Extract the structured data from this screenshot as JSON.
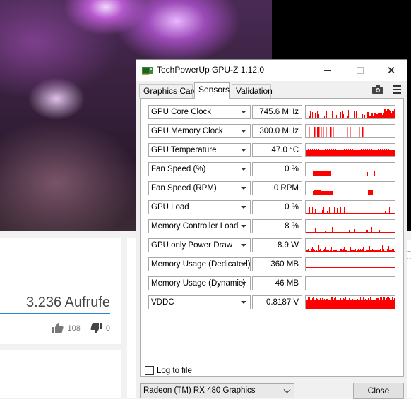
{
  "youtube": {
    "views": "3.236 Aufrufe",
    "likes": "108",
    "dislikes": "0"
  },
  "window": {
    "title": "TechPowerUp GPU-Z 1.12.0",
    "close_glyph": "✕",
    "tabs": [
      "Graphics Card",
      "Sensors",
      "Validation"
    ],
    "active_tab": "Sensors",
    "accent": "#ff0000"
  },
  "sensors": [
    {
      "name": "GPU Core Clock",
      "value": "745.6 MHz",
      "graph": "spiky"
    },
    {
      "name": "GPU Memory Clock",
      "value": "300.0 MHz",
      "graph": "bars"
    },
    {
      "name": "GPU Temperature",
      "value": "47.0 °C",
      "graph": "flat-high"
    },
    {
      "name": "Fan Speed (%)",
      "value": "0 %",
      "graph": "blocks"
    },
    {
      "name": "Fan Speed (RPM)",
      "value": "0 RPM",
      "graph": "blocks2"
    },
    {
      "name": "GPU Load",
      "value": "0 %",
      "graph": "sparse"
    },
    {
      "name": "Memory Controller Load",
      "value": "8 %",
      "graph": "sparse2"
    },
    {
      "name": "GPU only Power Draw",
      "value": "8.9 W",
      "graph": "low-noise"
    },
    {
      "name": "Memory Usage (Dedicated)",
      "value": "360 MB",
      "graph": "line"
    },
    {
      "name": "Memory Usage (Dynamic)",
      "value": "46 MB",
      "graph": "empty"
    },
    {
      "name": "VDDC",
      "value": "0.8187 V",
      "graph": "full"
    }
  ],
  "footer": {
    "log_label": "Log to file",
    "gpu": "Radeon (TM) RX 480 Graphics",
    "close": "Close"
  }
}
